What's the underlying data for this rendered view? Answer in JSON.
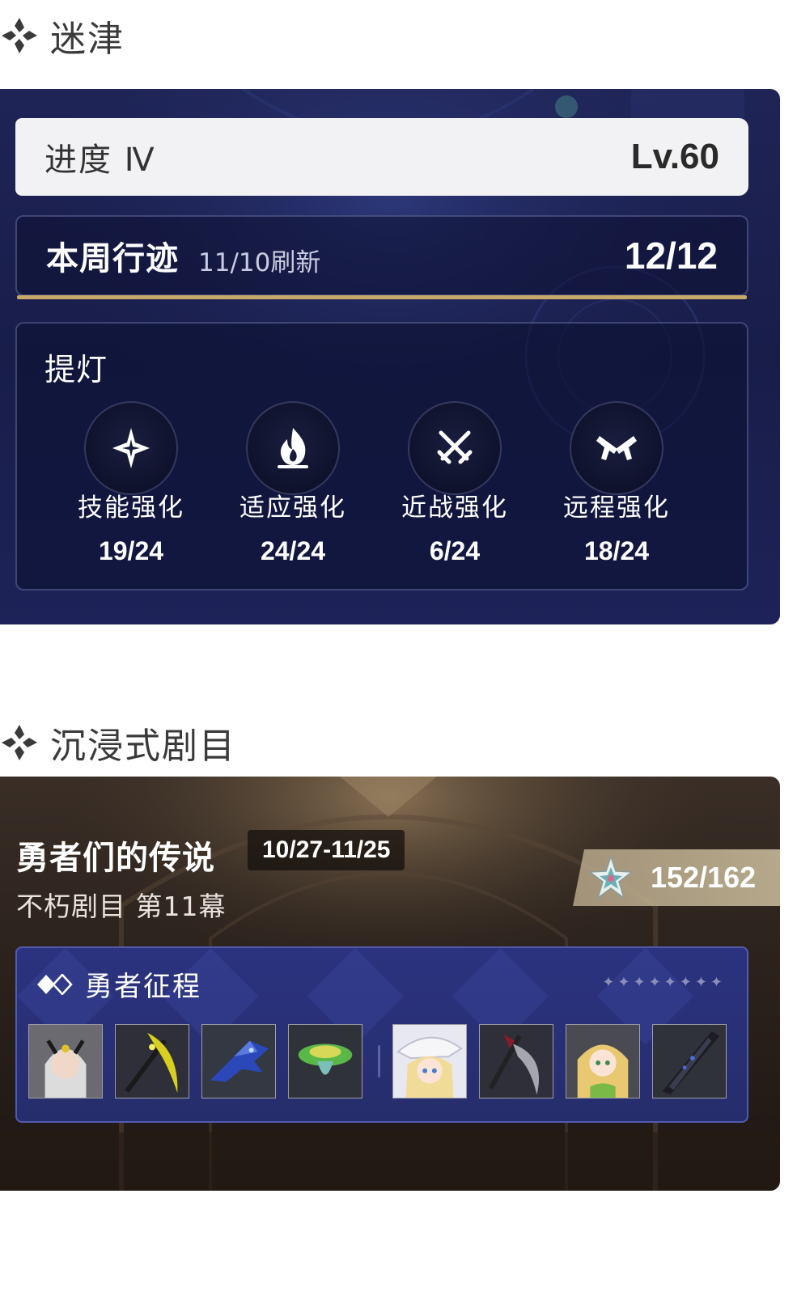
{
  "labyrinth": {
    "section_title": "迷津",
    "progress_label": "进度 Ⅳ",
    "level": "Lv.60",
    "weekly": {
      "title": "本周行迹",
      "refresh": "11/10刷新",
      "count": "12/12"
    },
    "lamp": {
      "title": "提灯",
      "items": [
        {
          "name": "技能强化",
          "count": "19/24",
          "icon": "sparkle-star-icon"
        },
        {
          "name": "适应强化",
          "count": "24/24",
          "icon": "flame-icon"
        },
        {
          "name": "近战强化",
          "count": "6/24",
          "icon": "crossed-swords-icon"
        },
        {
          "name": "远程强化",
          "count": "18/24",
          "icon": "crossed-pistols-icon"
        }
      ]
    }
  },
  "drama": {
    "section_title": "沉浸式剧目",
    "title": "勇者们的传说",
    "date_range": "10/27-11/25",
    "subtitle": "不朽剧目 第11幕",
    "score": "152/162",
    "journey": {
      "title": "勇者征程",
      "rewards_group_1": [
        "character-portrait-icon",
        "yellow-scythe-icon",
        "blue-dragon-weapon-icon",
        "mushroom-pet-icon"
      ],
      "rewards_group_2": [
        "witch-girl-portrait-icon",
        "dark-scythe-icon",
        "blonde-girl-portrait-icon",
        "greatsword-icon"
      ]
    }
  },
  "colors": {
    "labyrinth_bg": "#1e2456",
    "gold_accent": "#c6a868",
    "journey_bg": "#2b3380"
  }
}
